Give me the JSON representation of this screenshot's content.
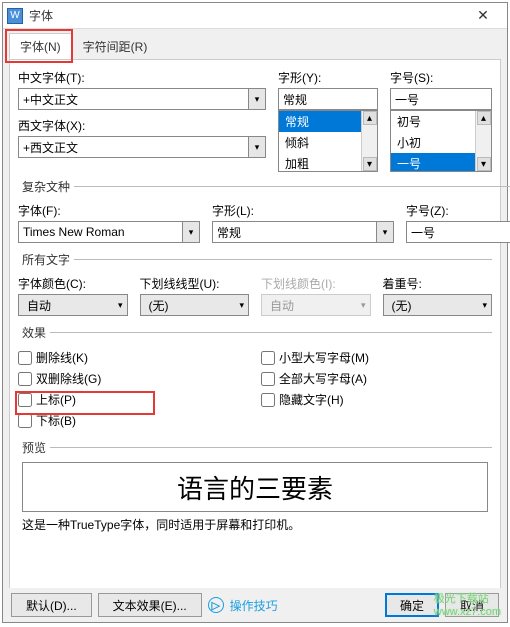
{
  "title": "字体",
  "close_symbol": "✕",
  "tabs": {
    "font": "字体(N)",
    "spacing": "字符间距(R)"
  },
  "labels": {
    "chinese_font": "中文字体(T):",
    "western_font": "西文字体(X):",
    "style": "字形(Y):",
    "size": "字号(S):",
    "complex_section": "复杂文种",
    "font_f": "字体(F):",
    "style_l": "字形(L):",
    "size_z": "字号(Z):",
    "all_text_section": "所有文字",
    "font_color": "字体颜色(C):",
    "underline_type": "下划线线型(U):",
    "underline_color": "下划线颜色(I):",
    "emphasis": "着重号:",
    "effects_section": "效果",
    "strike": "删除线(K)",
    "double_strike": "双删除线(G)",
    "superscript": "上标(P)",
    "subscript": "下标(B)",
    "small_caps": "小型大写字母(M)",
    "all_caps": "全部大写字母(A)",
    "hidden": "隐藏文字(H)",
    "preview_section": "预览",
    "desc_text": "这是一种TrueType字体，同时适用于屏幕和打印机。"
  },
  "values": {
    "chinese_font": "+中文正文",
    "western_font": "+西文正文",
    "style_input": "常规",
    "size_input": "一号",
    "style_options": [
      "常规",
      "倾斜",
      "加粗"
    ],
    "size_options": [
      "初号",
      "小初",
      "一号"
    ],
    "complex_font": "Times New Roman",
    "complex_style": "常规",
    "complex_size": "一号",
    "font_color": "自动",
    "underline": "(无)",
    "underline_color": "自动",
    "emphasis": "(无)",
    "preview_text": "语言的三要素"
  },
  "buttons": {
    "default": "默认(D)...",
    "text_effects": "文本效果(E)...",
    "tips": "操作技巧",
    "ok": "确定",
    "cancel": "取消"
  },
  "watermark": {
    "brand": "极光下载站",
    "url": "www.xz7.com"
  }
}
